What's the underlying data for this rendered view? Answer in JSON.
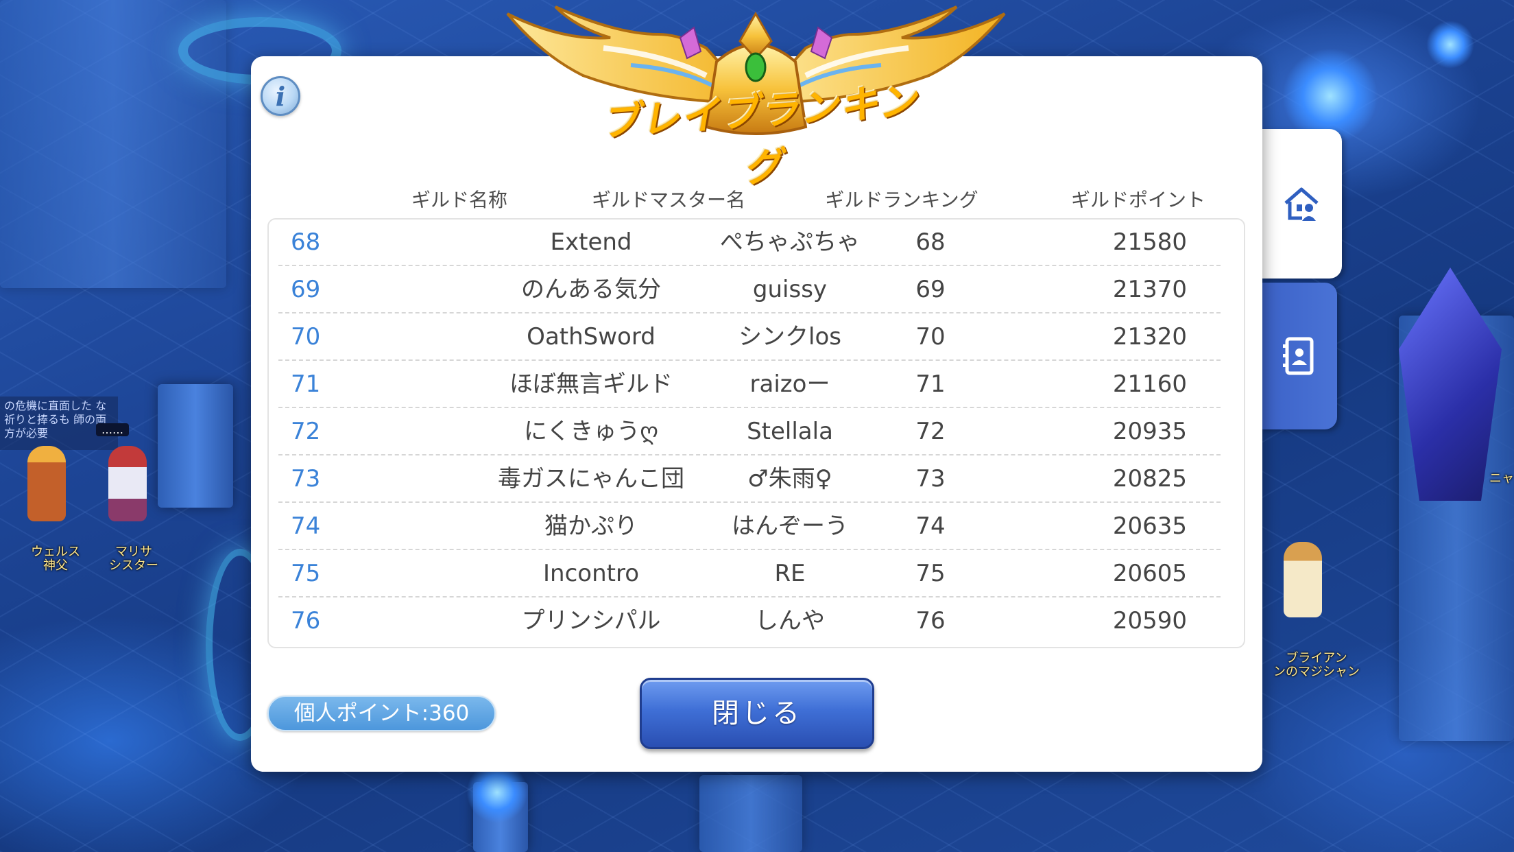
{
  "ranking_title": "ブレイブランキング",
  "info_label": "i",
  "columns": [
    "ギルド名称",
    "ギルドマスター名",
    "ギルドランキング",
    "ギルドポイント"
  ],
  "rows": [
    {
      "rank": "68",
      "guild": "Extend",
      "master": "ぺちゃぷちゃ",
      "guild_rank": "68",
      "points": "21580"
    },
    {
      "rank": "69",
      "guild": "のんある気分",
      "master": "guissy",
      "guild_rank": "69",
      "points": "21370"
    },
    {
      "rank": "70",
      "guild": "OathSword",
      "master": "シンクlos",
      "guild_rank": "70",
      "points": "21320"
    },
    {
      "rank": "71",
      "guild": "ほぼ無言ギルド",
      "master": "raizoー",
      "guild_rank": "71",
      "points": "21160"
    },
    {
      "rank": "72",
      "guild": "にくきゅうღ",
      "master": "Stellala",
      "guild_rank": "72",
      "points": "20935"
    },
    {
      "rank": "73",
      "guild": "毒ガスにゃんこ団",
      "master": "♂朱雨♀",
      "guild_rank": "73",
      "points": "20825"
    },
    {
      "rank": "74",
      "guild": "猫かぷり",
      "master": "はんぞーう",
      "guild_rank": "74",
      "points": "20635"
    },
    {
      "rank": "75",
      "guild": "Incontro",
      "master": "RE",
      "guild_rank": "75",
      "points": "20605"
    },
    {
      "rank": "76",
      "guild": "プリンシパル",
      "master": "しんや",
      "guild_rank": "76",
      "points": "20590"
    }
  ],
  "personal_points": "個人ポイント:360",
  "close_label": "閉じる",
  "world": {
    "npc_left_label": "ウェルス\n神父",
    "npc_right_label": "マリサ\nシスター",
    "npc_far_label": "ブライアン\nンのマジシャン",
    "chat_text": "の危機に直面した\nな祈りと捧るも\n師の両方が必要",
    "dots_tag": "……",
    "edge_text": "ニャ"
  },
  "colors": {
    "rank_number": "#3a82d8",
    "close_button": "#3f6fd6",
    "personal_pill": "#5da3e2",
    "active_tab": "#ffffff",
    "inactive_tab": "#4468cc"
  },
  "icons": {
    "info": "info-icon",
    "guild_house_tab": "guild-house-icon",
    "member_book_tab": "member-book-icon"
  }
}
